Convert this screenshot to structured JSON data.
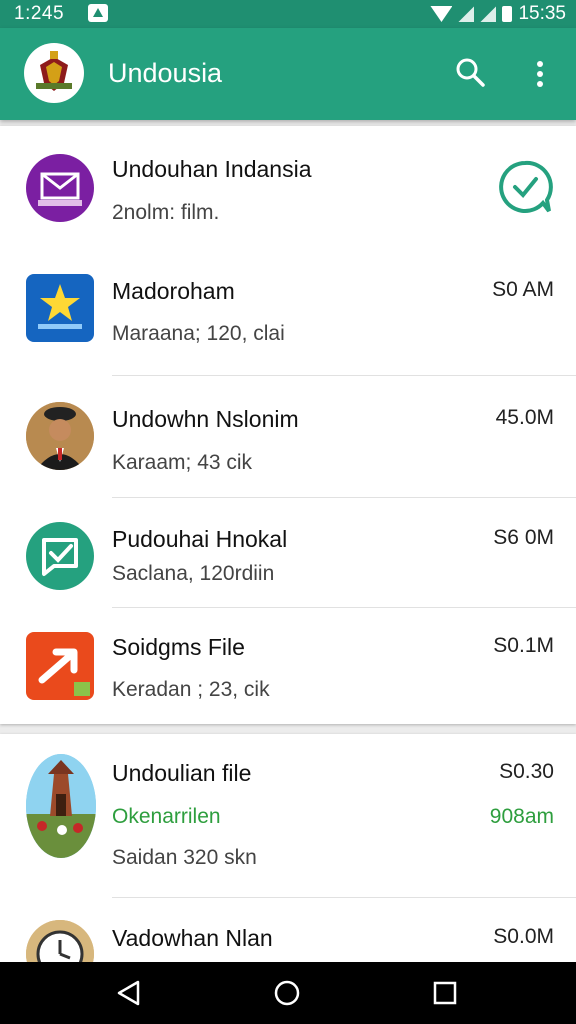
{
  "status_bar": {
    "time": "1:245",
    "clock": "15:35",
    "icons": [
      "notification-icon",
      "wifi-icon",
      "signal-icon",
      "signal-icon",
      "battery-icon"
    ]
  },
  "app_bar": {
    "title": "Undousia",
    "icons": [
      "app-logo",
      "search-icon",
      "more-vert-icon"
    ]
  },
  "items": [
    {
      "title": "Undouhan Indansia",
      "subtitle": "2nolm: film.",
      "status_icon": "check-chat-icon",
      "avatar_icon": "mail-app-icon",
      "avatar_color": "#7b1fa2"
    },
    {
      "title": "Madoroham",
      "subtitle": "Maraana; 120, clai",
      "time": "S0 AM",
      "avatar_icon": "star-app-icon",
      "avatar_color": "#1565c0"
    },
    {
      "title": "Undowhn Nslonim",
      "subtitle": "Karaam; 43 cik",
      "time": "45.0M",
      "avatar_icon": "person-avatar"
    },
    {
      "title": "Pudouhai Hnokal",
      "subtitle": "Saclana, 120rdiin",
      "time": "S6 0M",
      "avatar_icon": "chat-check-app-icon",
      "avatar_color": "#25a17f"
    },
    {
      "title": "Soidgms File",
      "subtitle": "Keradan ; 23, cik",
      "time": "S0.1M",
      "avatar_icon": "share-arrow-app-icon",
      "avatar_color": "#ea4a1c"
    },
    {
      "title": "Undoulian file",
      "highlight": "Okenarrilen",
      "highlight_time": "908am",
      "subtitle": "Saidan 320   skn",
      "time": "S0.30",
      "avatar_icon": "landmark-photo-avatar"
    },
    {
      "title": "Vadowhan Nlan",
      "time": "S0.0M",
      "avatar_icon": "clock-avatar"
    }
  ],
  "nav_bar": {
    "icons": [
      "back-icon",
      "home-icon",
      "recents-icon"
    ]
  },
  "colors": {
    "primary": "#25a17f",
    "status_bar": "#1f8f71",
    "accent_green": "#2e9e3e"
  }
}
